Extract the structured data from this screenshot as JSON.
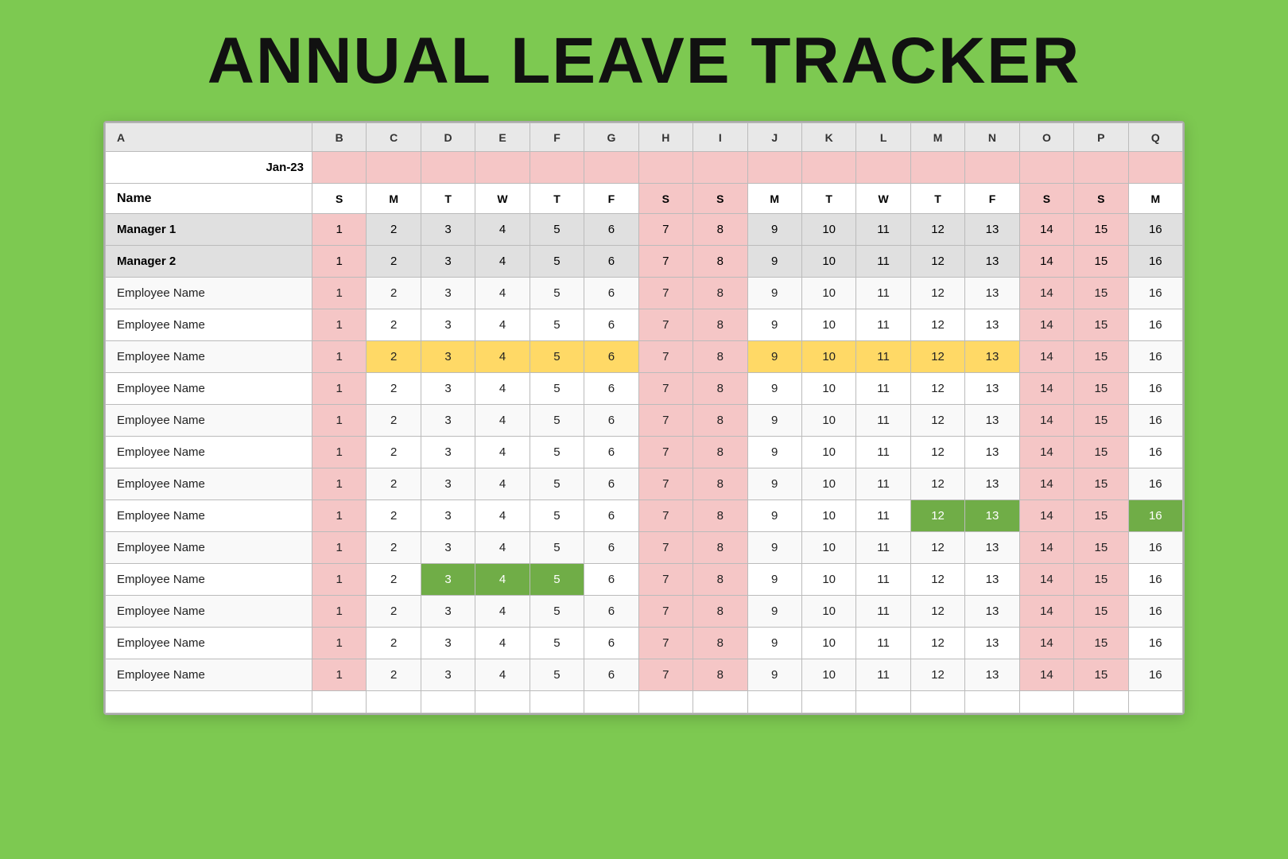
{
  "title": "ANNUAL LEAVE TRACKER",
  "spreadsheet": {
    "col_letters": [
      "A",
      "B",
      "C",
      "D",
      "E",
      "F",
      "G",
      "H",
      "I",
      "J",
      "K",
      "L",
      "M",
      "N",
      "O",
      "P",
      "Q"
    ],
    "month": "Jan-23",
    "day_letters": [
      "",
      "S",
      "M",
      "T",
      "W",
      "T",
      "F",
      "S",
      "S",
      "M",
      "T",
      "W",
      "T",
      "F",
      "S",
      "S",
      "M"
    ],
    "name_col": "Name",
    "day_numbers": [
      1,
      2,
      3,
      4,
      5,
      6,
      7,
      8,
      9,
      10,
      11,
      12,
      13,
      14,
      15,
      16
    ],
    "rows": [
      {
        "name": "Manager 1",
        "type": "manager",
        "highlights": []
      },
      {
        "name": "Manager 2",
        "type": "manager",
        "highlights": []
      },
      {
        "name": "Employee Name",
        "type": "employee",
        "highlights": []
      },
      {
        "name": "Employee Name",
        "type": "employee",
        "highlights": []
      },
      {
        "name": "Employee Name",
        "type": "employee",
        "highlights": [
          2,
          3,
          4,
          5,
          6,
          9,
          10,
          11,
          12,
          13
        ]
      },
      {
        "name": "Employee Name",
        "type": "employee",
        "highlights": []
      },
      {
        "name": "Employee Name",
        "type": "employee",
        "highlights": []
      },
      {
        "name": "Employee Name",
        "type": "employee",
        "highlights": []
      },
      {
        "name": "Employee Name",
        "type": "employee",
        "highlights": []
      },
      {
        "name": "Employee Name",
        "type": "employee",
        "highlights_green": [
          12,
          13,
          16
        ],
        "highlights": []
      },
      {
        "name": "Employee Name",
        "type": "employee",
        "highlights": []
      },
      {
        "name": "Employee Name",
        "type": "employee",
        "highlights_green": [
          3,
          4,
          5
        ],
        "highlights": []
      },
      {
        "name": "Employee Name",
        "type": "employee",
        "highlights": []
      },
      {
        "name": "Employee Name",
        "type": "employee",
        "highlights": []
      },
      {
        "name": "Employee Name",
        "type": "employee",
        "highlights": []
      }
    ]
  }
}
